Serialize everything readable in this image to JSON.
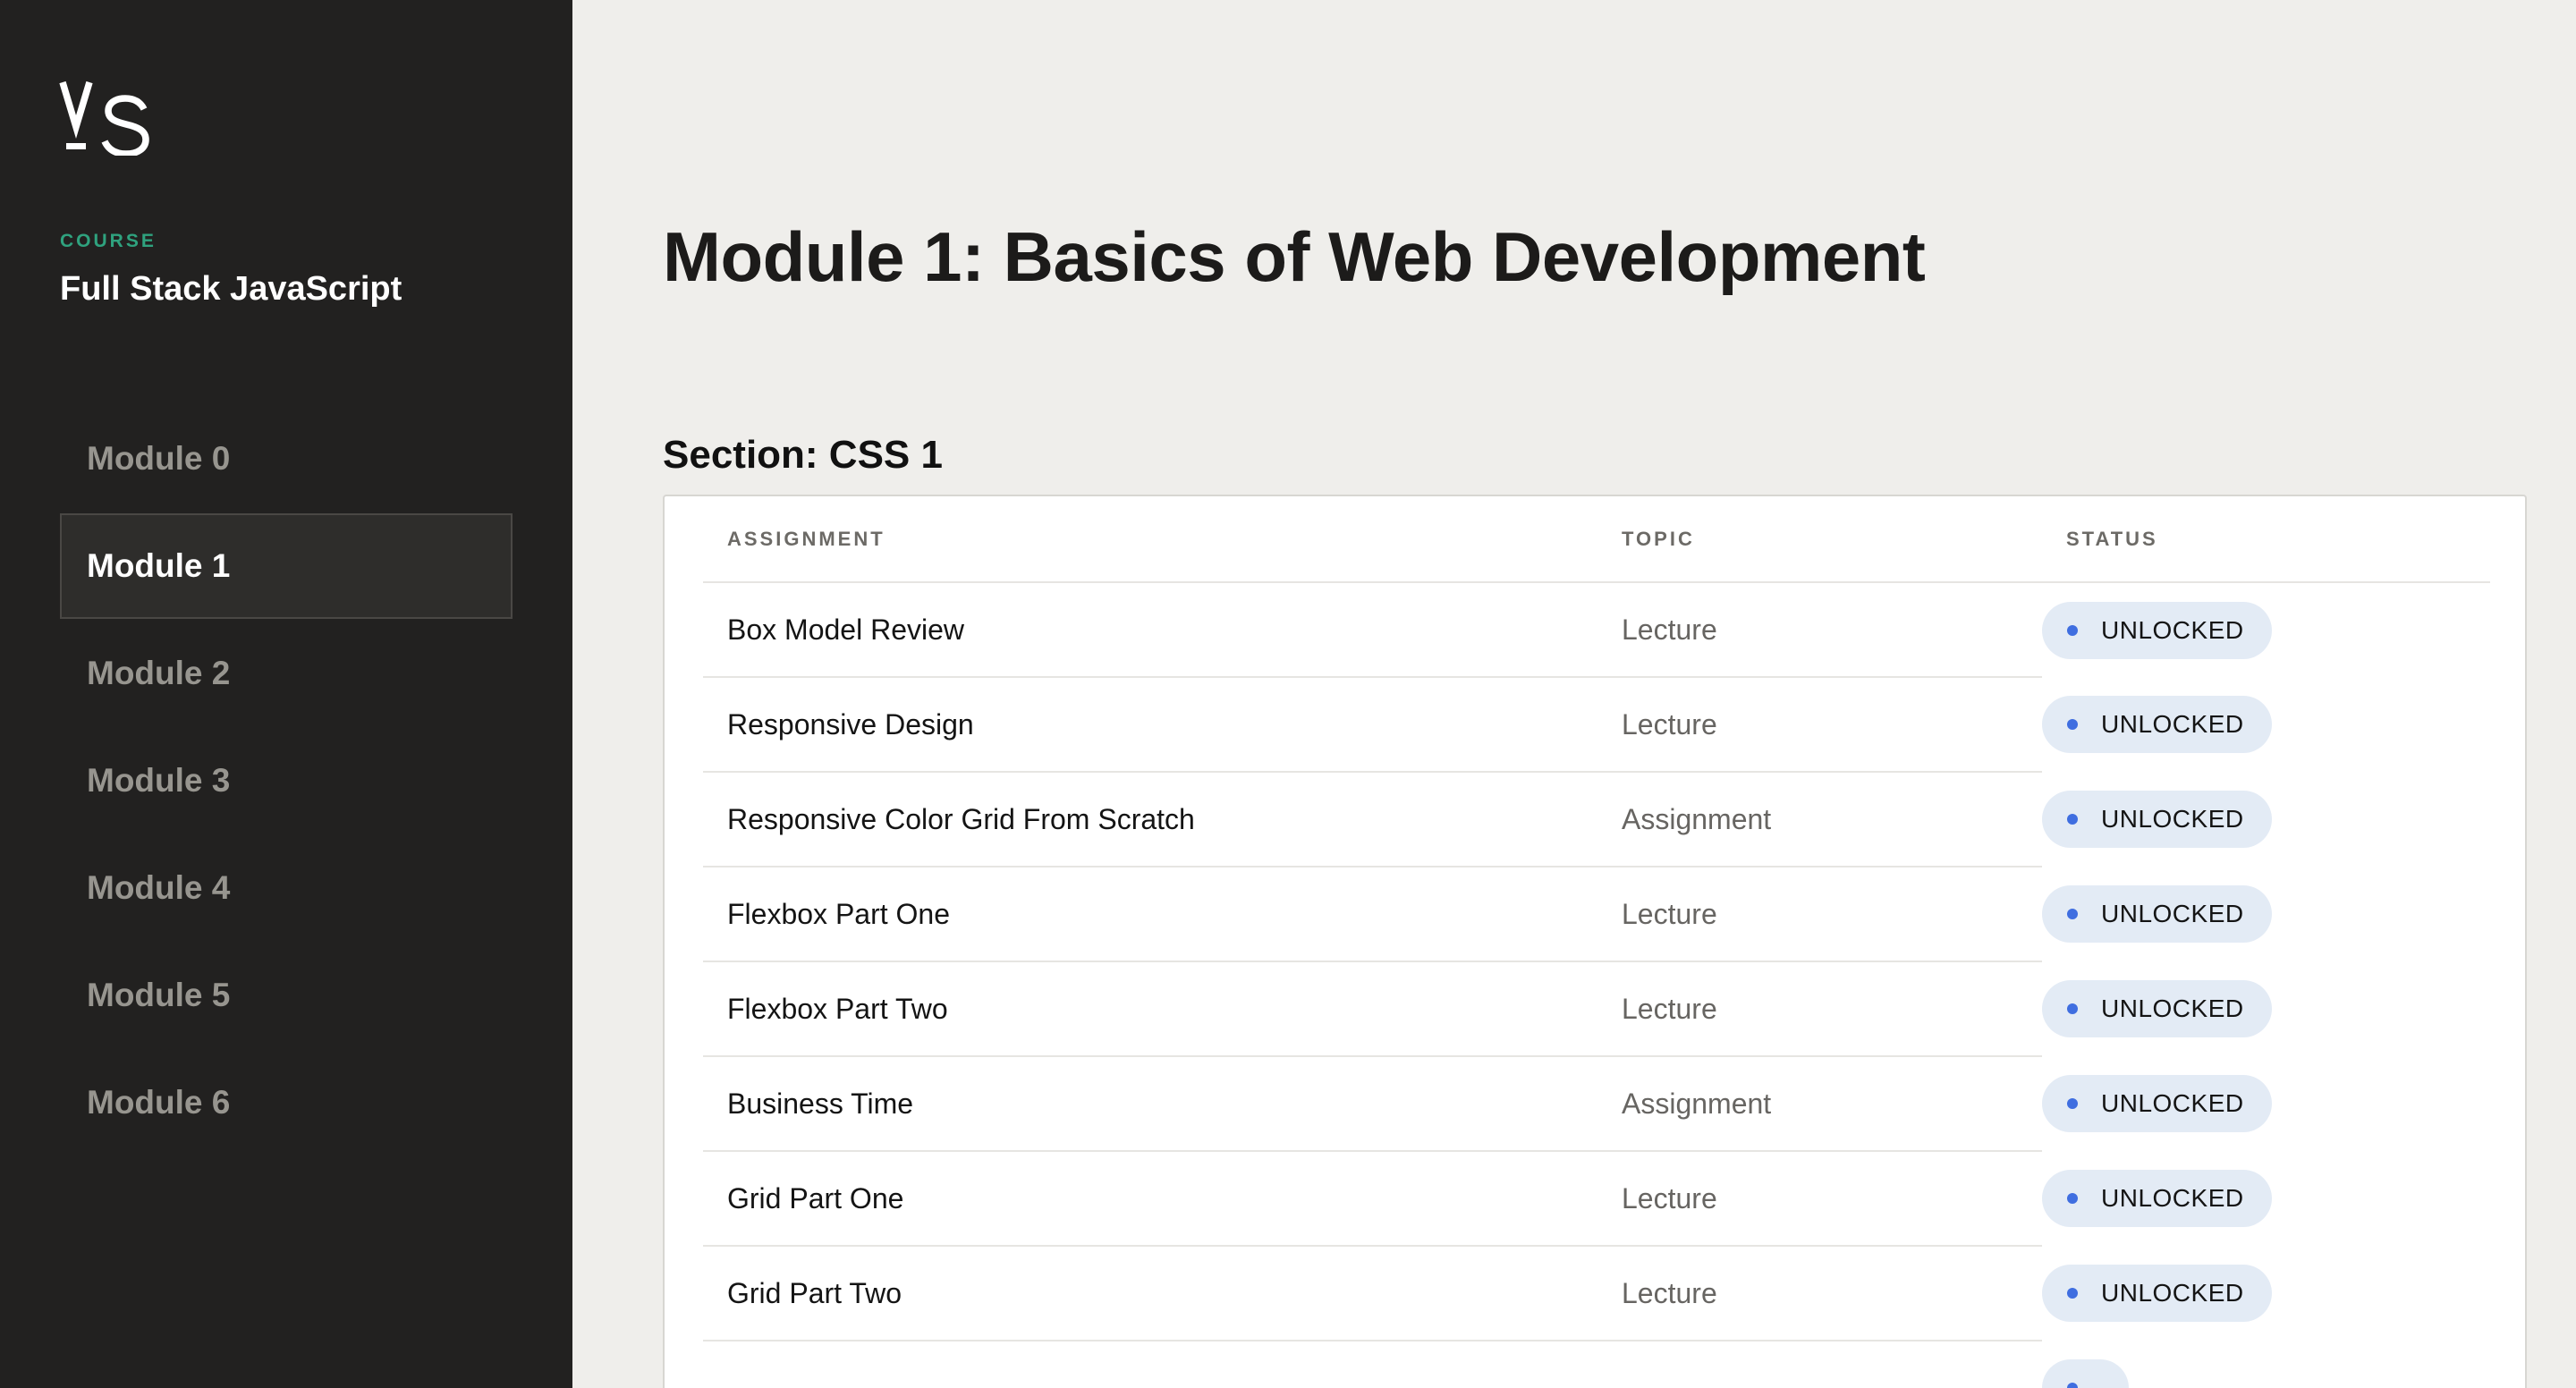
{
  "sidebar": {
    "course_label": "COURSE",
    "course_title": "Full Stack JavaScript",
    "active_index": 1,
    "modules": [
      {
        "label": "Module 0"
      },
      {
        "label": "Module 1"
      },
      {
        "label": "Module 2"
      },
      {
        "label": "Module 3"
      },
      {
        "label": "Module 4"
      },
      {
        "label": "Module 5"
      },
      {
        "label": "Module 6"
      }
    ]
  },
  "main": {
    "title": "Module 1: Basics of Web Development",
    "section": {
      "title": "Section: CSS 1",
      "columns": [
        "ASSIGNMENT",
        "TOPIC",
        "STATUS"
      ],
      "rows": [
        {
          "assignment": "Box Model Review",
          "topic": "Lecture",
          "status": "UNLOCKED"
        },
        {
          "assignment": "Responsive Design",
          "topic": "Lecture",
          "status": "UNLOCKED"
        },
        {
          "assignment": "Responsive Color Grid From Scratch",
          "topic": "Assignment",
          "status": "UNLOCKED"
        },
        {
          "assignment": "Flexbox Part One",
          "topic": "Lecture",
          "status": "UNLOCKED"
        },
        {
          "assignment": "Flexbox Part Two",
          "topic": "Lecture",
          "status": "UNLOCKED"
        },
        {
          "assignment": "Business Time",
          "topic": "Assignment",
          "status": "UNLOCKED"
        },
        {
          "assignment": "Grid Part One",
          "topic": "Lecture",
          "status": "UNLOCKED"
        },
        {
          "assignment": "Grid Part Two",
          "topic": "Lecture",
          "status": "UNLOCKED"
        },
        {
          "assignment": "",
          "topic": "",
          "status": ""
        }
      ]
    }
  },
  "colors": {
    "sidebar_bg": "#222120",
    "page_bg": "#efeeeb",
    "course_label": "#2fa27e",
    "badge_bg": "#e3ebf5",
    "badge_dot": "#3f6ee0"
  }
}
